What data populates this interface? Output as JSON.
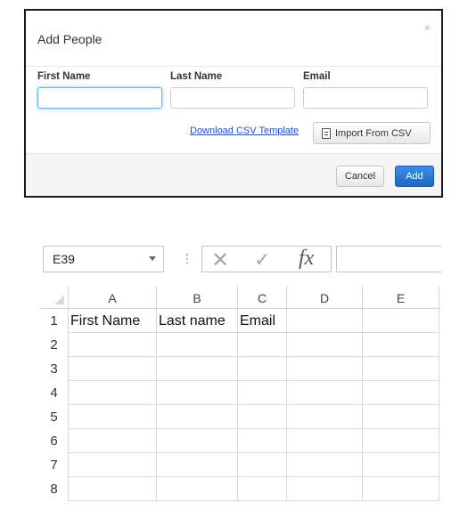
{
  "dialog": {
    "title": "Add People",
    "close_icon": "×",
    "fields": [
      {
        "label": "First Name",
        "value": "",
        "focused": true
      },
      {
        "label": "Last Name",
        "value": "",
        "focused": false
      },
      {
        "label": "Email",
        "value": "",
        "focused": false
      }
    ],
    "download_link": "Download CSV Template",
    "import_button": "Import From CSV",
    "cancel_button": "Cancel",
    "add_button": "Add",
    "accent_color": "#1e66c7"
  },
  "spreadsheet": {
    "name_box": "E39",
    "toolbar_icons": [
      "more-options-icon",
      "cancel-x-icon",
      "enter-check-icon",
      "insert-function-icon"
    ],
    "cancel_glyph": "✕",
    "check_glyph": "✓",
    "fx_label": "fx",
    "formula_value": "",
    "columns": [
      "A",
      "B",
      "C",
      "D",
      "E"
    ],
    "rows": [
      "1",
      "2",
      "3",
      "4",
      "5",
      "6",
      "7",
      "8"
    ],
    "cells": [
      [
        "First Name",
        "Last name",
        "Email",
        "",
        ""
      ],
      [
        "",
        "",
        "",
        "",
        ""
      ],
      [
        "",
        "",
        "",
        "",
        ""
      ],
      [
        "",
        "",
        "",
        "",
        ""
      ],
      [
        "",
        "",
        "",
        "",
        ""
      ],
      [
        "",
        "",
        "",
        "",
        ""
      ],
      [
        "",
        "",
        "",
        "",
        ""
      ],
      [
        "",
        "",
        "",
        "",
        ""
      ]
    ]
  }
}
